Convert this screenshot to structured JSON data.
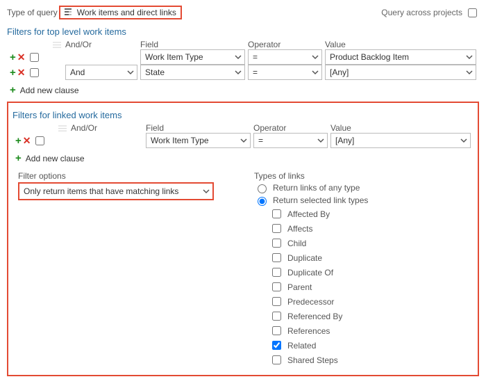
{
  "topRow": {
    "typeOfQueryLabel": "Type of query",
    "queryTypeValue": "Work items and direct links",
    "acrossProjectsLabel": "Query across projects",
    "acrossProjectsChecked": false
  },
  "columns": {
    "andOr": "And/Or",
    "field": "Field",
    "operator": "Operator",
    "value": "Value"
  },
  "topFilters": {
    "header": "Filters for top level work items",
    "rows": [
      {
        "andOr": "",
        "field": "Work Item Type",
        "operator": "=",
        "value": "Product Backlog Item"
      },
      {
        "andOr": "And",
        "field": "State",
        "operator": "=",
        "value": "[Any]"
      }
    ],
    "addClauseLabel": "Add new clause"
  },
  "linkedFilters": {
    "header": "Filters for linked work items",
    "rows": [
      {
        "andOr": "",
        "field": "Work Item Type",
        "operator": "=",
        "value": "[Any]"
      }
    ],
    "addClauseLabel": "Add new clause"
  },
  "filterOptions": {
    "label": "Filter options",
    "selected": "Only return items that have matching links"
  },
  "linkTypes": {
    "label": "Types of links",
    "radioAnyLabel": "Return links of any type",
    "radioSelectedLabel": "Return selected link types",
    "radioSelected": "selected",
    "items": [
      {
        "label": "Affected By",
        "checked": false
      },
      {
        "label": "Affects",
        "checked": false
      },
      {
        "label": "Child",
        "checked": false
      },
      {
        "label": "Duplicate",
        "checked": false
      },
      {
        "label": "Duplicate Of",
        "checked": false
      },
      {
        "label": "Parent",
        "checked": false
      },
      {
        "label": "Predecessor",
        "checked": false
      },
      {
        "label": "Referenced By",
        "checked": false
      },
      {
        "label": "References",
        "checked": false
      },
      {
        "label": "Related",
        "checked": true
      },
      {
        "label": "Shared Steps",
        "checked": false
      }
    ]
  }
}
